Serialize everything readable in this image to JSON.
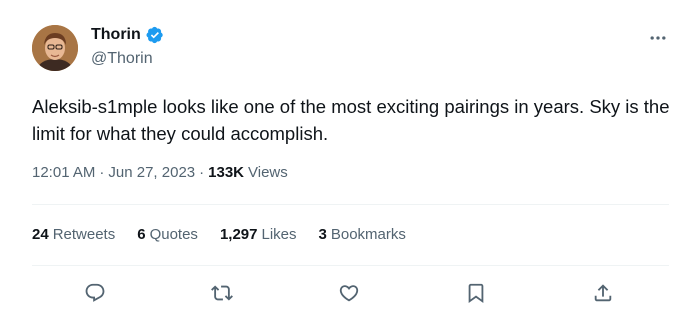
{
  "author": {
    "name": "Thorin",
    "handle": "@Thorin",
    "verified_color": "#1d9bf0"
  },
  "tweet": {
    "text": "Aleksib-s1mple looks like one of the most exciting pairings in years.  Sky is the limit for what they could accomplish."
  },
  "meta": {
    "time": "12:01 AM",
    "separator1": "·",
    "date": "Jun 27, 2023",
    "separator2": "·",
    "views_count": "133K",
    "views_label": "Views"
  },
  "stats": [
    {
      "count": "24",
      "label": "Retweets"
    },
    {
      "count": "6",
      "label": "Quotes"
    },
    {
      "count": "1,297",
      "label": "Likes"
    },
    {
      "count": "3",
      "label": "Bookmarks"
    }
  ],
  "icons": {
    "more": "more-horizontal-icon",
    "reply": "reply-icon",
    "retweet": "retweet-icon",
    "like": "heart-icon",
    "bookmark": "bookmark-icon",
    "share": "share-icon"
  },
  "colors": {
    "text": "#0f1419",
    "secondary": "#536471",
    "divider": "#eff3f4",
    "verified": "#1d9bf0"
  }
}
